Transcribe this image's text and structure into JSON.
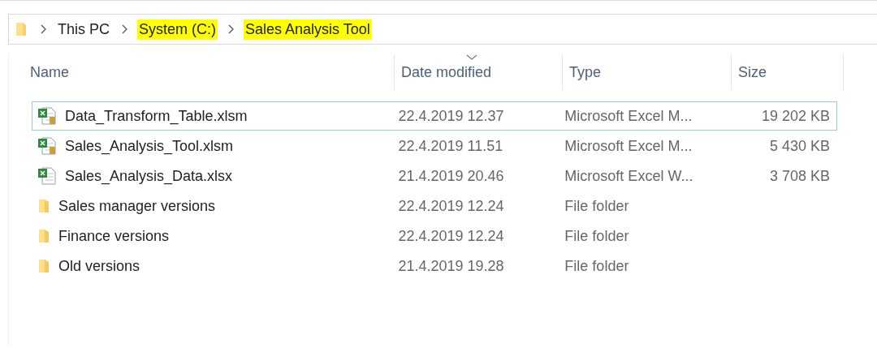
{
  "breadcrumb": [
    {
      "label": "This PC",
      "highlighted": false
    },
    {
      "label": "System (C:)",
      "highlighted": true
    },
    {
      "label": "Sales Analysis Tool",
      "highlighted": true
    }
  ],
  "table": {
    "columns": [
      {
        "label": "Name",
        "sorted": false
      },
      {
        "label": "Date modified",
        "sorted": true
      },
      {
        "label": "Type",
        "sorted": false
      },
      {
        "label": "Size",
        "sorted": false
      }
    ],
    "rows": [
      {
        "kind": "excel-macro",
        "name": "Data_Transform_Table.xlsm",
        "date": "22.4.2019 12.37",
        "type": "Microsoft Excel M...",
        "size": "19 202 KB",
        "focused": true
      },
      {
        "kind": "excel-macro",
        "name": "Sales_Analysis_Tool.xlsm",
        "date": "22.4.2019 11.51",
        "type": "Microsoft Excel M...",
        "size": "5 430 KB",
        "focused": false
      },
      {
        "kind": "excel",
        "name": "Sales_Analysis_Data.xlsx",
        "date": "21.4.2019 20.46",
        "type": "Microsoft Excel W...",
        "size": "3 708 KB",
        "focused": false
      },
      {
        "kind": "folder",
        "name": "Sales manager versions",
        "date": "22.4.2019 12.24",
        "type": "File folder",
        "focused": false
      },
      {
        "kind": "folder",
        "name": "Finance versions",
        "date": "22.4.2019 12.24",
        "type": "File folder",
        "focused": false
      },
      {
        "kind": "folder",
        "name": "Old versions",
        "date": "21.4.2019 19.28",
        "type": "File folder",
        "focused": false
      }
    ]
  }
}
